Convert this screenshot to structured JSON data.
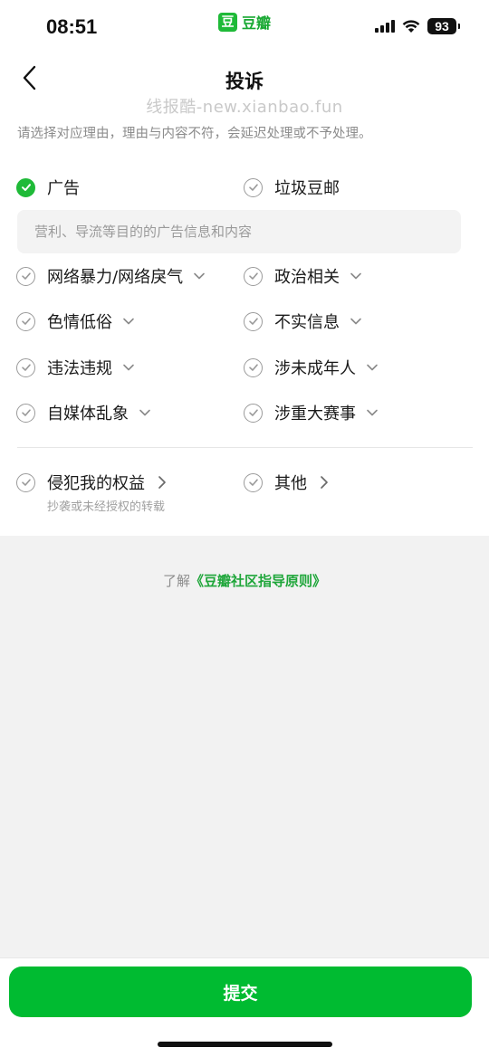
{
  "status_bar": {
    "time": "08:51",
    "app_name": "豆瓣",
    "app_logo_char": "豆",
    "battery": "93"
  },
  "nav": {
    "back_icon": "chevron-left-icon",
    "title": "投诉"
  },
  "watermark": "线报酷-new.xianbao.fun",
  "instruction": "请选择对应理由，理由与内容不符，会延迟处理或不予处理。",
  "options": [
    {
      "label": "广告",
      "selected": true
    },
    {
      "label": "垃圾豆邮",
      "selected": false
    },
    {
      "label": "网络暴力/网络戾气",
      "selected": false,
      "expandable": true
    },
    {
      "label": "政治相关",
      "selected": false,
      "expandable": true
    },
    {
      "label": "色情低俗",
      "selected": false,
      "expandable": true
    },
    {
      "label": "不实信息",
      "selected": false,
      "expandable": true
    },
    {
      "label": "违法违规",
      "selected": false,
      "expandable": true
    },
    {
      "label": "涉未成年人",
      "selected": false,
      "expandable": true
    },
    {
      "label": "自媒体乱象",
      "selected": false,
      "expandable": true
    },
    {
      "label": "涉重大赛事",
      "selected": false,
      "expandable": true
    }
  ],
  "selected_description": "营利、导流等目的的广告信息和内容",
  "extra_options": [
    {
      "label": "侵犯我的权益",
      "sublabel": "抄袭或未经授权的转载"
    },
    {
      "label": "其他"
    }
  ],
  "guide": {
    "prefix": "了解",
    "link": "《豆瓣社区指导原则》"
  },
  "submit_label": "提交",
  "colors": {
    "accent": "#1fba38",
    "submit": "#00bb31",
    "link": "#1fa63a"
  }
}
